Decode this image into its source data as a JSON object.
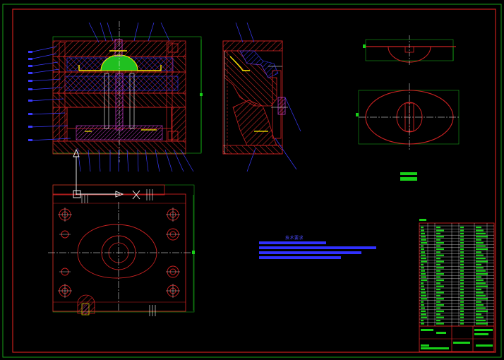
{
  "colors": {
    "background": "#000000",
    "frame": "#c8201c",
    "outline": "#cc2222",
    "hatch": "#d0302a",
    "blue": "#3a3aff",
    "yellow": "#ffee00",
    "green": "#18d018",
    "white": "#ffffff",
    "magenta": "#d040d0"
  },
  "drawing": {
    "technical_notes_title": "技术要求",
    "views": [
      "mold-section-main",
      "mold-section-side",
      "part-elevation",
      "part-plan",
      "mold-plan-view"
    ],
    "title_block": "title-block-with-parts-list"
  }
}
